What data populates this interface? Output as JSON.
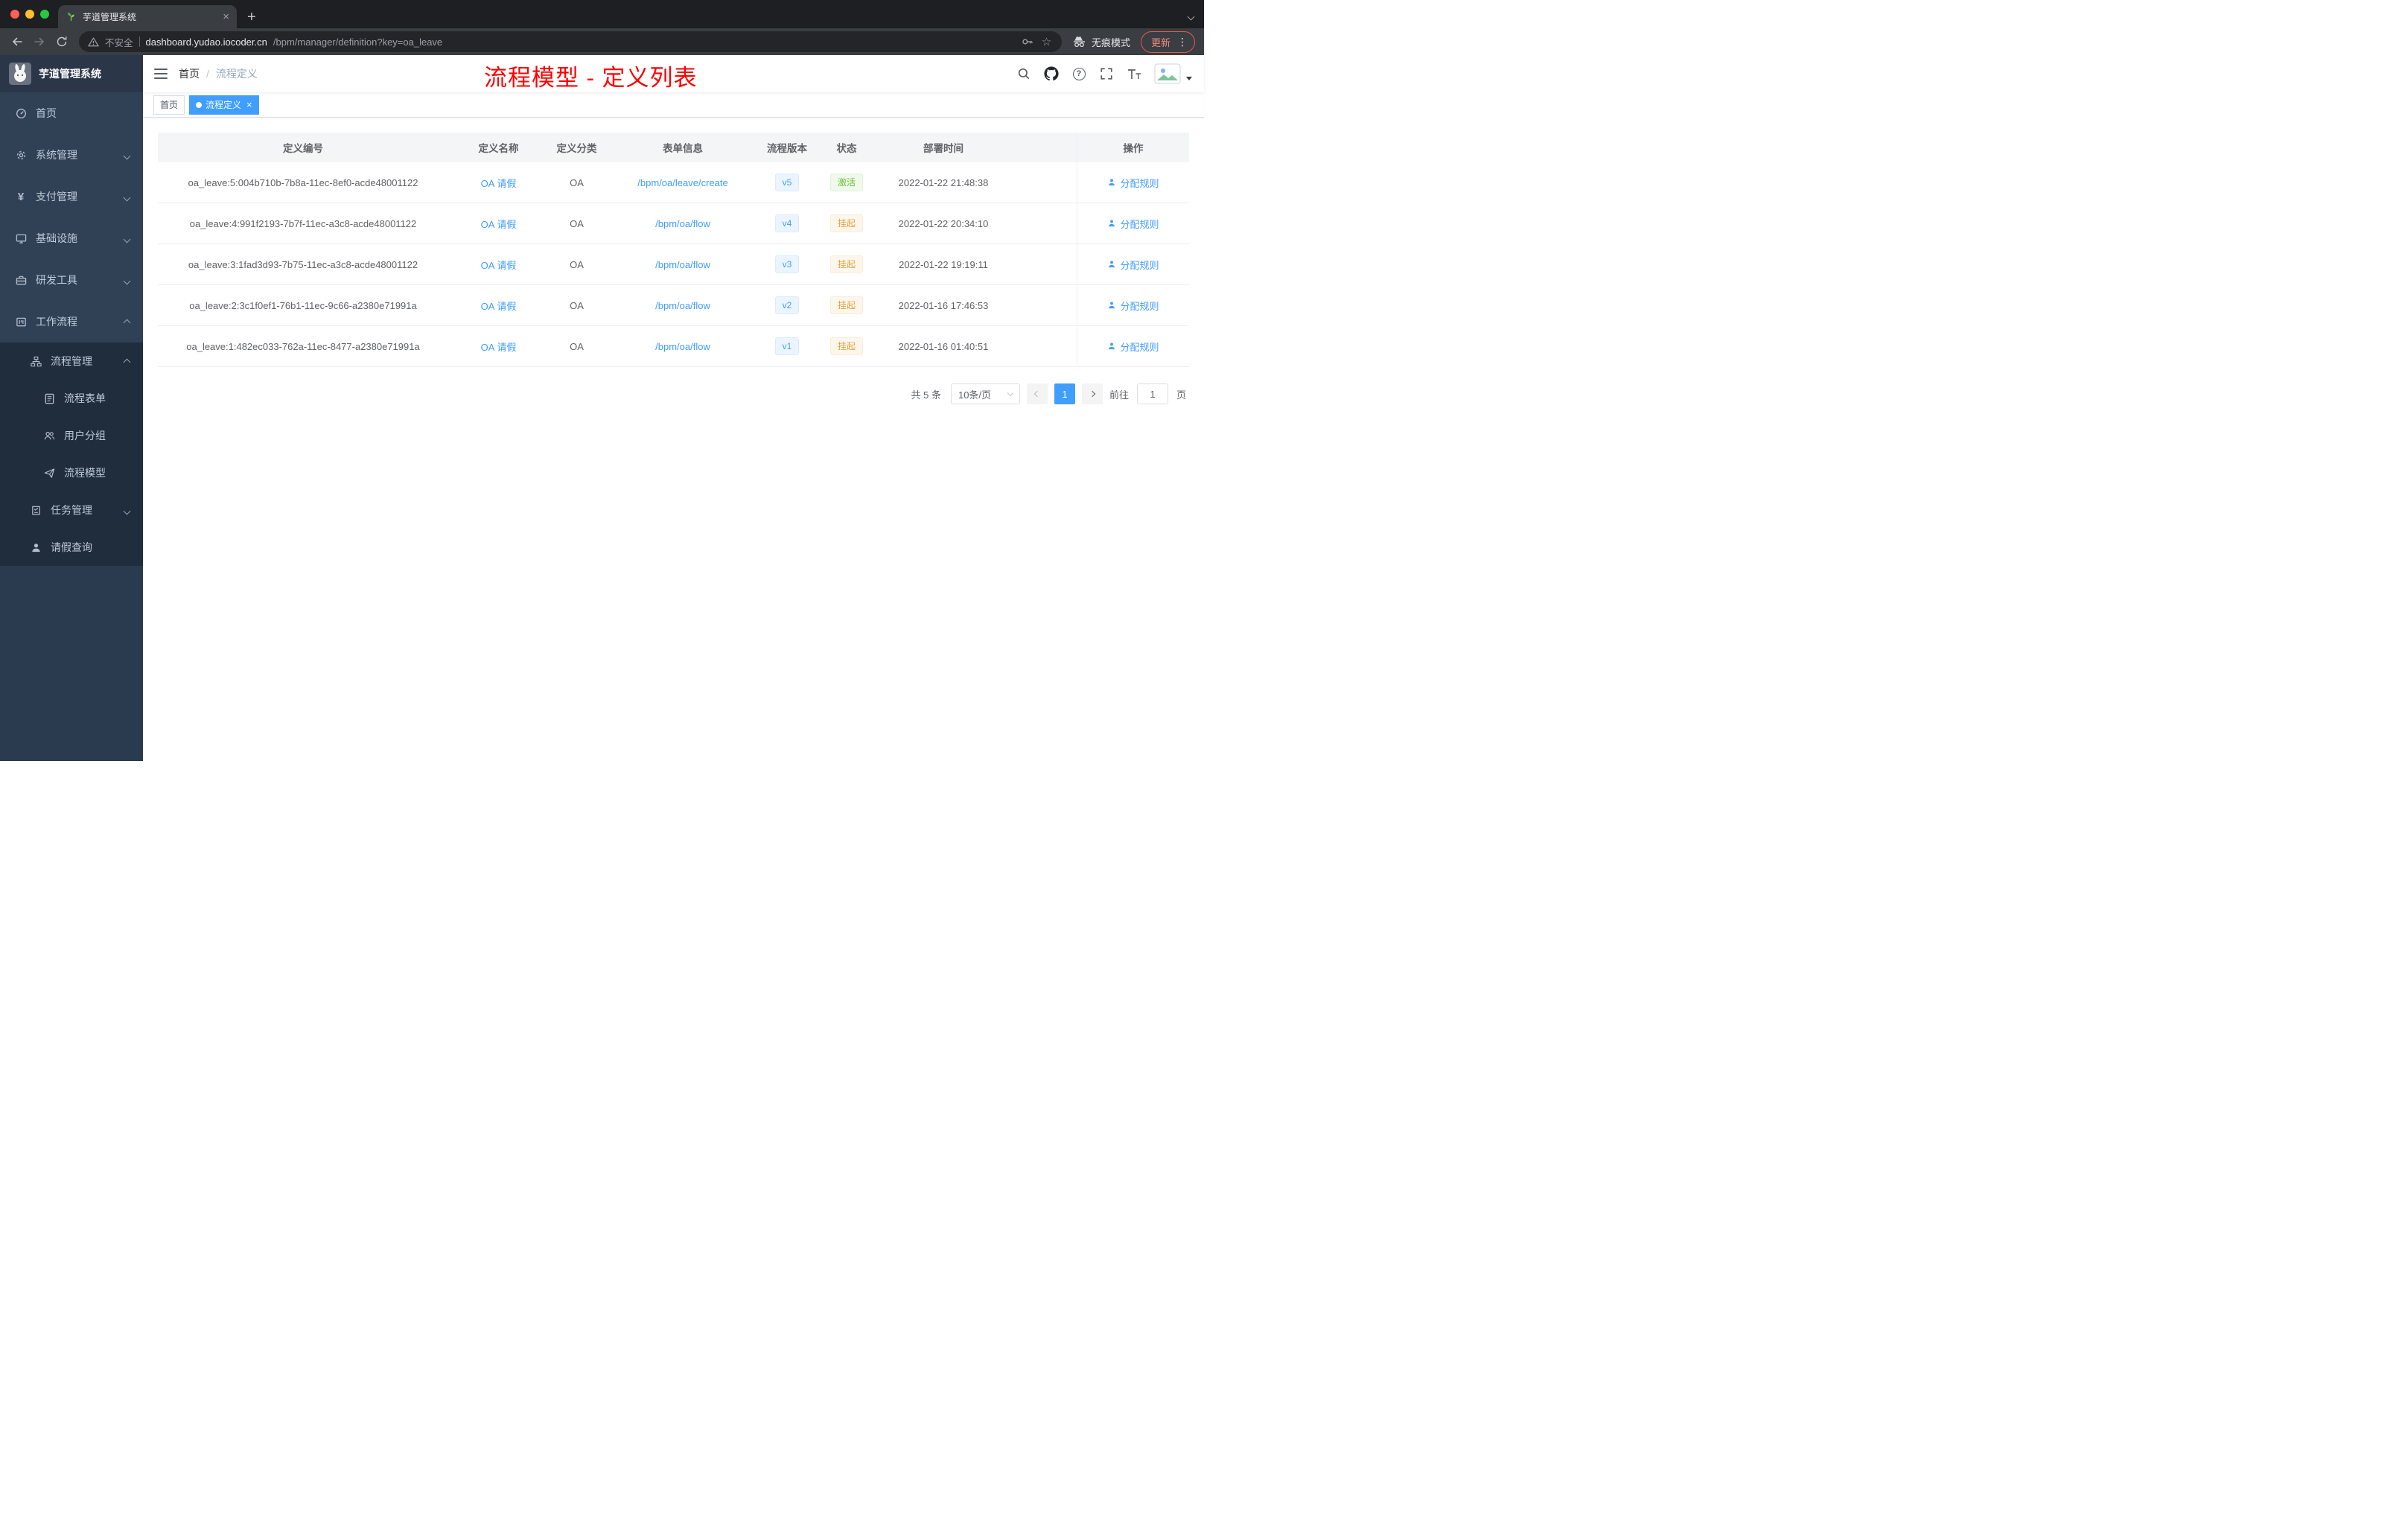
{
  "browser": {
    "tab_title": "芋道管理系统",
    "security_label": "不安全",
    "url_domain": "dashboard.yudao.iocoder.cn",
    "url_path": "/bpm/manager/definition?key=oa_leave",
    "incognito_label": "无痕模式",
    "update_label": "更新"
  },
  "sidebar": {
    "app_title": "芋道管理系统",
    "items": [
      {
        "key": "home",
        "label": "首页",
        "icon": "dashboard",
        "level": 1
      },
      {
        "key": "system-mgmt",
        "label": "系统管理",
        "icon": "gear",
        "level": 1,
        "arrow": "down"
      },
      {
        "key": "payment-mgmt",
        "label": "支付管理",
        "icon": "yen",
        "level": 1,
        "arrow": "down"
      },
      {
        "key": "infrastructure",
        "label": "基础设施",
        "icon": "monitor",
        "level": 1,
        "arrow": "down"
      },
      {
        "key": "dev-tools",
        "label": "研发工具",
        "icon": "toolbox",
        "level": 1,
        "arrow": "down"
      },
      {
        "key": "workflow",
        "label": "工作流程",
        "icon": "workflow",
        "level": 1,
        "arrow": "up"
      },
      {
        "key": "process-mgmt",
        "label": "流程管理",
        "icon": "tree",
        "level": 2,
        "arrow": "up"
      },
      {
        "key": "process-form",
        "label": "流程表单",
        "icon": "form",
        "level": 3
      },
      {
        "key": "user-group",
        "label": "用户分组",
        "icon": "people",
        "level": 3
      },
      {
        "key": "process-model",
        "label": "流程模型",
        "icon": "send",
        "level": 3
      },
      {
        "key": "task-mgmt",
        "label": "任务管理",
        "icon": "task",
        "level": 2,
        "arrow": "down"
      },
      {
        "key": "leave-query",
        "label": "请假查询",
        "icon": "user",
        "level": 2
      }
    ]
  },
  "navbar": {
    "breadcrumb": [
      "首页",
      "流程定义"
    ],
    "breadcrumb_separator": "/",
    "annotation": "流程模型 - 定义列表"
  },
  "tags": [
    {
      "label": "首页",
      "active": false,
      "closable": false
    },
    {
      "label": "流程定义",
      "active": true,
      "closable": true
    }
  ],
  "table": {
    "columns": [
      {
        "key": "id",
        "label": "定义编号"
      },
      {
        "key": "name",
        "label": "定义名称"
      },
      {
        "key": "category",
        "label": "定义分类"
      },
      {
        "key": "form",
        "label": "表单信息"
      },
      {
        "key": "version",
        "label": "流程版本"
      },
      {
        "key": "status",
        "label": "状态"
      },
      {
        "key": "time",
        "label": "部署时间"
      },
      {
        "key": "action",
        "label": "操作"
      }
    ],
    "rows": [
      {
        "id": "oa_leave:5:004b710b-7b8a-11ec-8ef0-acde48001122",
        "name": "OA 请假",
        "category": "OA",
        "form": "/bpm/oa/leave/create",
        "version": "v5",
        "status": "激活",
        "status_type": "success",
        "time": "2022-01-22 21:48:38",
        "action": "分配规则"
      },
      {
        "id": "oa_leave:4:991f2193-7b7f-11ec-a3c8-acde48001122",
        "name": "OA 请假",
        "category": "OA",
        "form": "/bpm/oa/flow",
        "version": "v4",
        "status": "挂起",
        "status_type": "warning",
        "time": "2022-01-22 20:34:10",
        "action": "分配规则"
      },
      {
        "id": "oa_leave:3:1fad3d93-7b75-11ec-a3c8-acde48001122",
        "name": "OA 请假",
        "category": "OA",
        "form": "/bpm/oa/flow",
        "version": "v3",
        "status": "挂起",
        "status_type": "warning",
        "time": "2022-01-22 19:19:11",
        "action": "分配规则"
      },
      {
        "id": "oa_leave:2:3c1f0ef1-76b1-11ec-9c66-a2380e71991a",
        "name": "OA 请假",
        "category": "OA",
        "form": "/bpm/oa/flow",
        "version": "v2",
        "status": "挂起",
        "status_type": "warning",
        "time": "2022-01-16 17:46:53",
        "action": "分配规则"
      },
      {
        "id": "oa_leave:1:482ec033-762a-11ec-8477-a2380e71991a",
        "name": "OA 请假",
        "category": "OA",
        "form": "/bpm/oa/flow",
        "version": "v1",
        "status": "挂起",
        "status_type": "warning",
        "time": "2022-01-16 01:40:51",
        "action": "分配规则"
      }
    ]
  },
  "pagination": {
    "total": "共 5 条",
    "page_size": "10条/页",
    "current_page": "1",
    "goto_label": "前往",
    "goto_value": "1",
    "page_unit": "页"
  },
  "colors": {
    "accent": "#409EFF",
    "annotation": "#FE0000",
    "success": "#67C23A",
    "warning": "#E6A23C",
    "sidebar_bg": "#304156",
    "submenu_bg": "#1F2D3D"
  }
}
